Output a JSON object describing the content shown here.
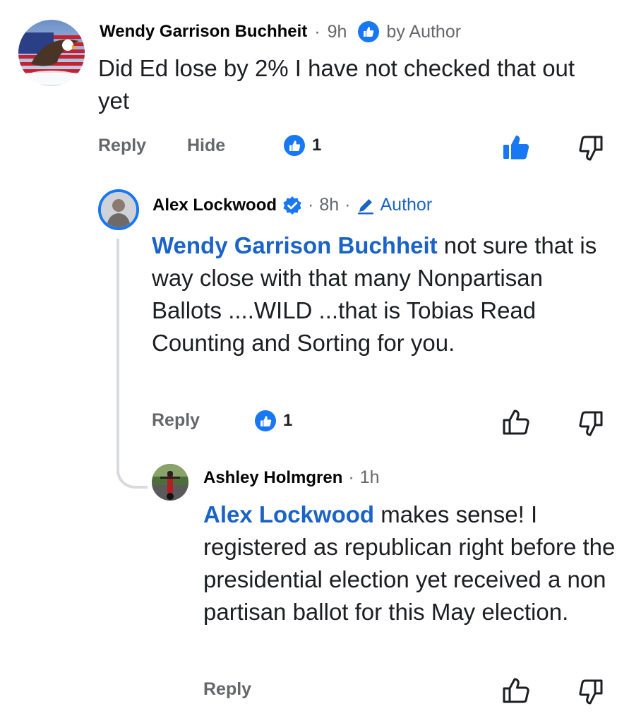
{
  "comments": [
    {
      "author": "Wendy Garrison Buchheit",
      "time": "9h",
      "badge": "by Author",
      "text": "Did Ed lose by 2%  I have not checked that out yet",
      "reply_label": "Reply",
      "hide_label": "Hide",
      "like_count": "1"
    },
    {
      "author": "Alex Lockwood",
      "time": "8h",
      "badge": "Author",
      "mention": "Wendy Garrison Buchheit",
      "text": " not sure that is way close with that many Nonpartisan Ballots ....WILD ...that is Tobias Read Counting and Sorting for you.",
      "reply_label": "Reply",
      "like_count": "1"
    },
    {
      "author": "Ashley Holmgren",
      "time": "1h",
      "mention": "Alex Lockwood",
      "text": " makes sense! I registered as republican right before the presidential election yet received a non partisan ballot for this May election.",
      "reply_label": "Reply"
    }
  ],
  "separator": "·",
  "colors": {
    "accent": "#1877f2",
    "mention": "#1a63c7",
    "meta": "#65676b"
  }
}
